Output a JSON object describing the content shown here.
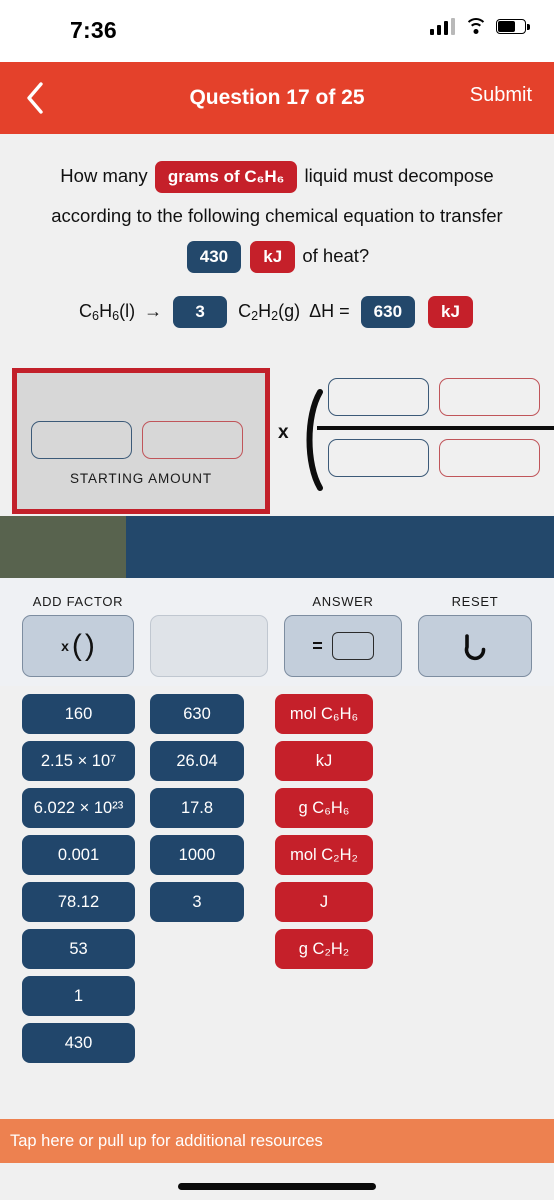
{
  "status_bar": {
    "time": "7:36",
    "cellular_icon": "cellular-bars-icon",
    "wifi_icon": "wifi-icon",
    "battery_icon": "battery-icon"
  },
  "nav": {
    "back_icon": "chevron-left-icon",
    "title": "Question 17 of 25",
    "submit_label": "Submit"
  },
  "question": {
    "line1_before": "How many",
    "highlight_unit": "grams of C₆H₆",
    "line1_after": "liquid must decompose",
    "line2": "according to the following chemical equation to transfer",
    "heat_value": "430",
    "heat_unit": "kJ",
    "line3_after": "of heat?"
  },
  "equation": {
    "reactant": "C₆H₆(l)",
    "arrow": "→",
    "coefficient": "3",
    "product": "C₂H₂(g)",
    "delta_h_label": "ΔH =",
    "delta_h_value": "630",
    "delta_h_unit": "kJ"
  },
  "work_area": {
    "starting_amount_label": "STARTING AMOUNT",
    "multiply_symbol": "x",
    "starting_slots": [
      {
        "name": "starting-value-slot",
        "kind": "blue",
        "value": ""
      },
      {
        "name": "starting-unit-slot",
        "kind": "red",
        "value": ""
      }
    ],
    "numerator_slots": [
      {
        "name": "numerator-value-slot",
        "kind": "blue",
        "value": ""
      },
      {
        "name": "numerator-unit-slot",
        "kind": "red",
        "value": ""
      }
    ],
    "denominator_slots": [
      {
        "name": "denominator-value-slot",
        "kind": "blue",
        "value": ""
      },
      {
        "name": "denominator-unit-slot",
        "kind": "red",
        "value": ""
      }
    ]
  },
  "toolbar": {
    "add_factor_label": "ADD FACTOR",
    "add_factor_glyph": "x ( )",
    "answer_label": "ANSWER",
    "answer_glyph": "=",
    "reset_label": "RESET",
    "reset_icon": "undo-arrow-icon"
  },
  "tiles": {
    "column_values_1": [
      "160",
      "2.15 × 10⁷",
      "6.022 × 10²³",
      "0.001",
      "78.12",
      "53",
      "1",
      "430"
    ],
    "column_values_2": [
      "630",
      "26.04",
      "17.8",
      "1000",
      "3"
    ],
    "column_units": [
      "mol C₆H₆",
      "kJ",
      "g C₆H₆",
      "mol C₂H₂",
      "J",
      "g C₂H₂"
    ]
  },
  "bottom_bar": {
    "text": "Tap here or pull up for additional resources"
  },
  "colors": {
    "nav_red": "#e4412b",
    "tile_navy": "#21466b",
    "tile_red": "#c5202a",
    "bottom_orange": "#ed8150",
    "olive": "#58634e",
    "navy_bar": "#23486b"
  }
}
